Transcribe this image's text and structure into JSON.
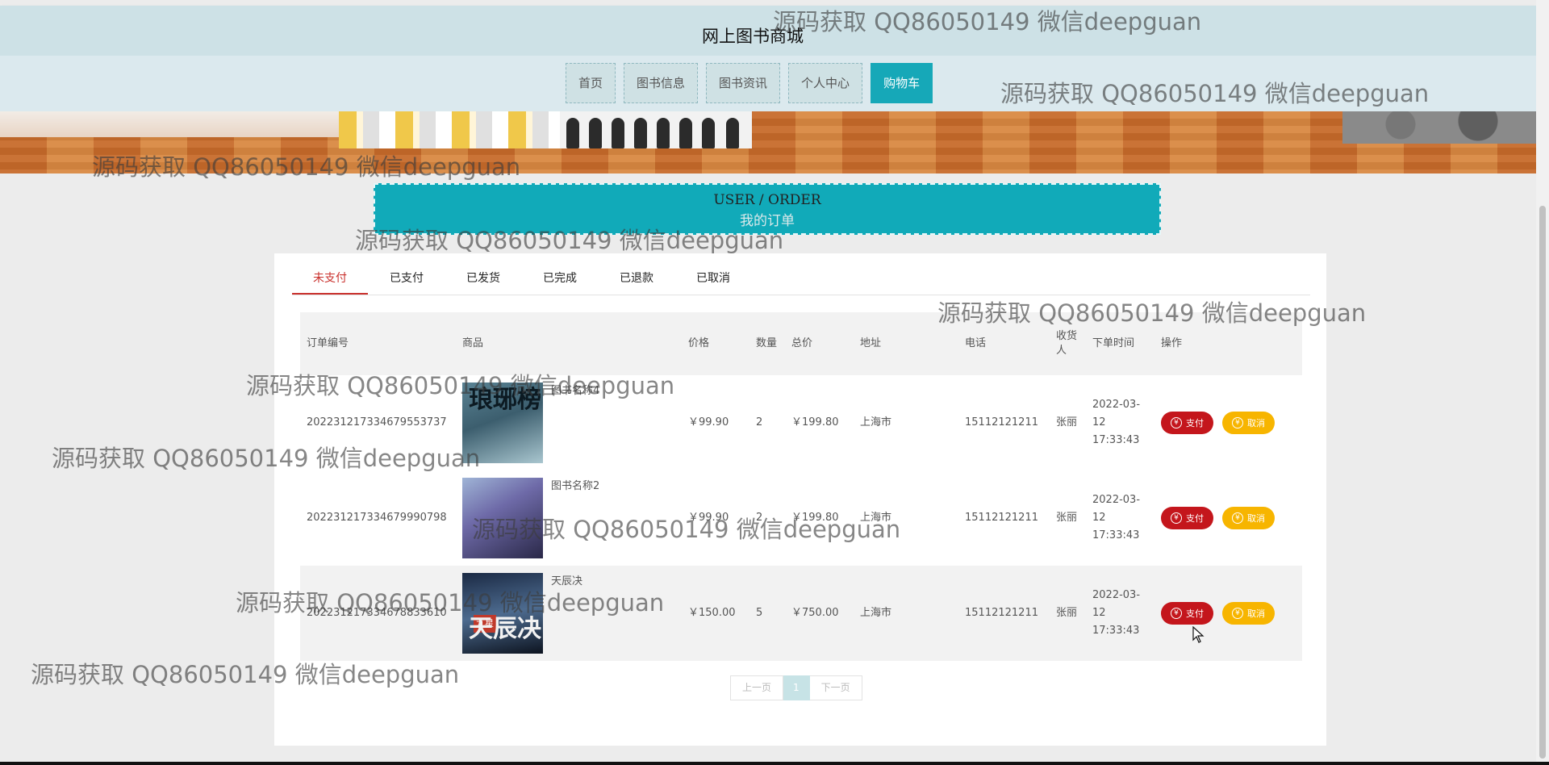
{
  "site": {
    "title": "网上图书商城"
  },
  "nav": [
    {
      "label": "首页",
      "active": false
    },
    {
      "label": "图书信息",
      "active": false
    },
    {
      "label": "图书资讯",
      "active": false
    },
    {
      "label": "个人中心",
      "active": false
    },
    {
      "label": "购物车",
      "active": true
    }
  ],
  "page_title": {
    "en": "USER / ORDER",
    "cn": "我的订单"
  },
  "tabs": [
    {
      "label": "未支付",
      "active": true
    },
    {
      "label": "已支付",
      "active": false
    },
    {
      "label": "已发货",
      "active": false
    },
    {
      "label": "已完成",
      "active": false
    },
    {
      "label": "已退款",
      "active": false
    },
    {
      "label": "已取消",
      "active": false
    }
  ],
  "table": {
    "headers": {
      "order_no": "订单编号",
      "goods": "商品",
      "price": "价格",
      "qty": "数量",
      "total": "总价",
      "address": "地址",
      "phone": "电话",
      "receiver": "收货人",
      "time": "下单时间",
      "action": "操作"
    },
    "rows": [
      {
        "order_no": "20223121733467955373​7",
        "name": "图书名称4",
        "cover_text": "琅琊榜",
        "price": "￥99.90",
        "qty": "2",
        "total": "￥199.80",
        "address": "上海市",
        "phone": "15112121211",
        "receiver": "张丽",
        "time": "2022-03-12 17:33:43"
      },
      {
        "order_no": "20223121733467999079​8",
        "name": "图书名称2",
        "cover_text": "",
        "price": "￥99.90",
        "qty": "2",
        "total": "￥199.80",
        "address": "上海市",
        "phone": "15112121211",
        "receiver": "张丽",
        "time": "2022-03-12 17:33:43"
      },
      {
        "order_no": "20223121733467883361​0",
        "name": "天辰决",
        "cover_text": "天辰决",
        "cover_badge": "九星",
        "price": "￥150.00",
        "qty": "5",
        "total": "￥750.00",
        "address": "上海市",
        "phone": "15112121211",
        "receiver": "张丽",
        "time": "2022-03-12 17:33:43"
      }
    ],
    "pay_label": "支付",
    "cancel_label": "取消",
    "yen_glyph": "¥"
  },
  "pager": {
    "prev": "上一页",
    "current": "1",
    "next": "下一页"
  },
  "watermark": "源码获取 QQ86050149 微信deepguan",
  "colors": {
    "accent": "#11aab9",
    "danger": "#c4161c",
    "warning": "#f7b500",
    "header": "#cde1e6"
  }
}
